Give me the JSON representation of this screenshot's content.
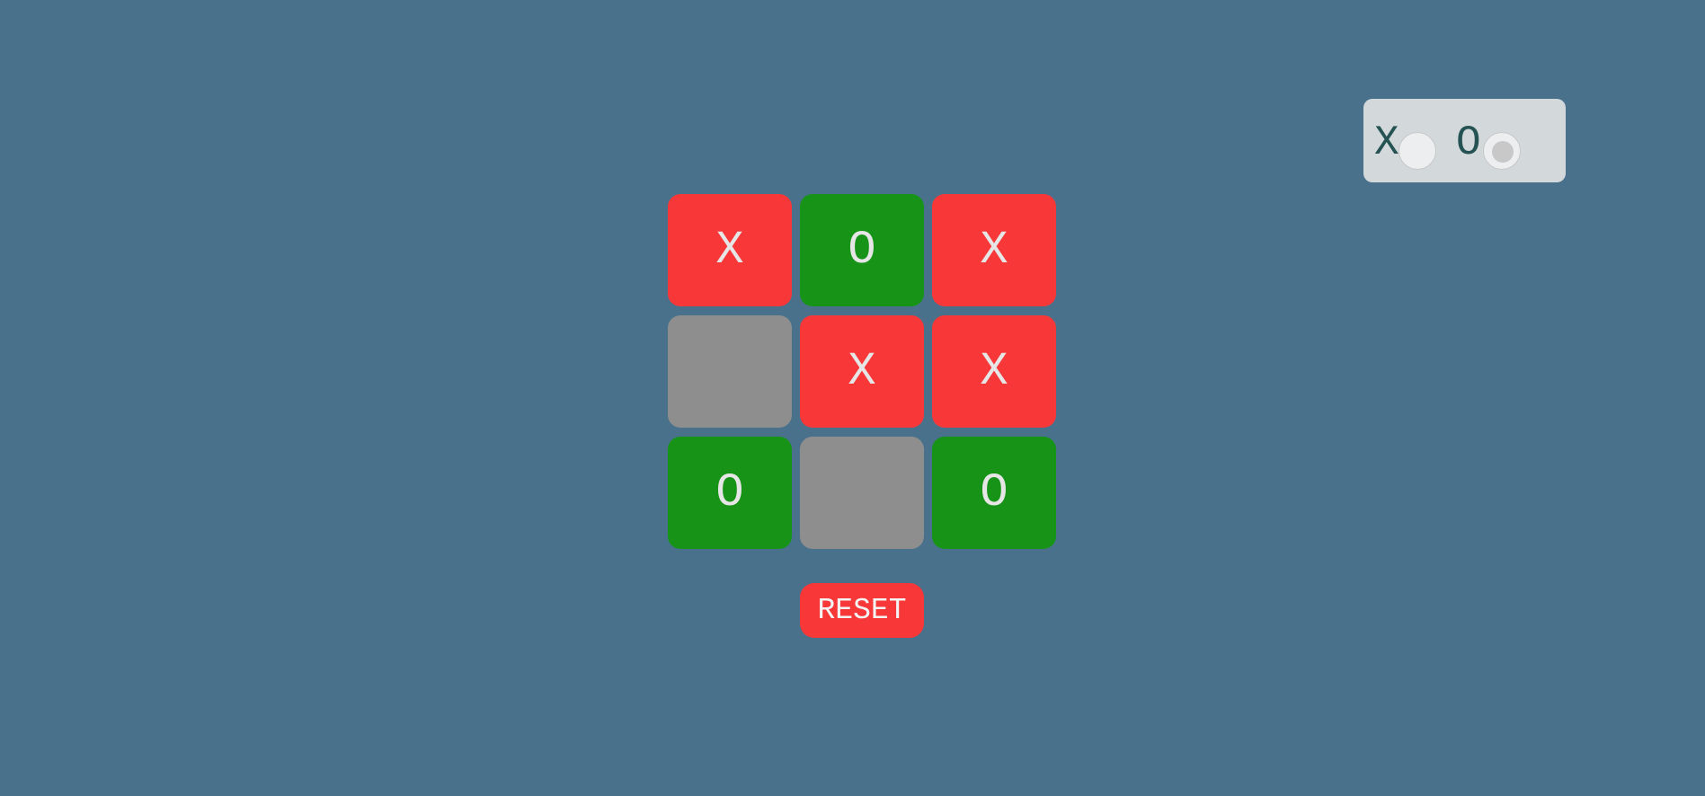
{
  "colors": {
    "background": "#4a718c",
    "x_cell": "#f83838",
    "o_cell": "#179418",
    "empty_cell": "#8e8e8e",
    "reset": "#f83838",
    "panel": "#d3d9db"
  },
  "board": {
    "cells": [
      "X",
      "O",
      "X",
      "",
      "X",
      "X",
      "O",
      "",
      "O"
    ]
  },
  "reset_label": "RESET",
  "player_select": {
    "options": [
      {
        "label": "X",
        "selected": false
      },
      {
        "label": "O",
        "selected": true
      }
    ]
  }
}
